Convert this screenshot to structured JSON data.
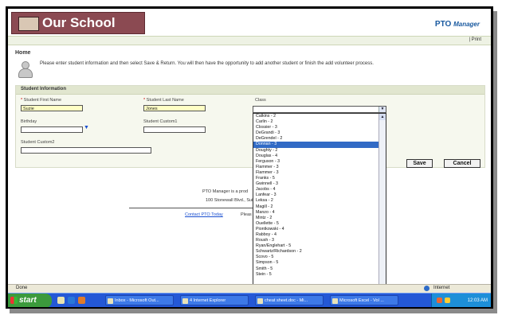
{
  "header": {
    "title": "Our School",
    "brand": "PTO",
    "brand_sub": "Manager",
    "print_link": "| Print"
  },
  "page": {
    "heading": "Home",
    "instructions": "Please enter student information and then select Save & Return. You will then have the opportunity to add another student or finish the add volunteer process."
  },
  "form": {
    "section_title": "Student Information",
    "first_name": {
      "label": "Student First Name",
      "value": "Suzie"
    },
    "last_name": {
      "label": "Student Last Name",
      "value": "Jones"
    },
    "class_label": "Class",
    "birthday": {
      "label": "Birthday",
      "value": ""
    },
    "custom1": {
      "label": "Student Custom1",
      "value": ""
    },
    "custom2": {
      "label": "Student Custom2",
      "value": ""
    }
  },
  "class_options": [
    "Calkins - 2",
    "Carlin - 2",
    "Clossier - 3",
    "DeGrandi - 3",
    "DeGrendel - 2",
    "Donnan - 3",
    "Doughty - 2",
    "Douglas - 4",
    "Ferguson - 3",
    "Flammer - 3",
    "Flammer - 3",
    "Franks - 5",
    "Gwinnell - 3",
    "Jacobs - 4",
    "Lanfear - 3",
    "Leksa - 2",
    "Magill - 2",
    "Manzo - 4",
    "Mintz - 2",
    "Ouellette - 5",
    "Piontkowski - 4",
    "Rabboy - 4",
    "Roush - 3",
    "Ryan/Englehart - 5",
    "Schwartz/Richardson - 2",
    "Scovo - 5",
    "Simpson - 5",
    "Smith - 5",
    "Stein - 5"
  ],
  "class_selected_index": 5,
  "buttons": {
    "save": "Save",
    "cancel": "Cancel"
  },
  "footer": {
    "line1": "PTO Manager is a prod",
    "line2": "100 Stonewall Blvd., Suite",
    "contact_link": "Contact PTO Today",
    "contact_rest": "Pleas"
  },
  "statusbar": {
    "done": "Done",
    "zone": "Internet"
  },
  "taskbar": {
    "start": "start",
    "tasks": [
      "Inbox - Microsoft Out...",
      "4 Internet Explorer",
      "cheat sheet.doc - Mi...",
      "Microsoft Excel - Vol ..."
    ],
    "clock": "12:03 AM"
  },
  "colors": {
    "header_bg": "#8b4a52",
    "brand_blue": "#1a5aa0",
    "select_highlight": "#316ac5",
    "taskbar_blue": "#2458d6",
    "start_green": "#3c9a3c"
  }
}
